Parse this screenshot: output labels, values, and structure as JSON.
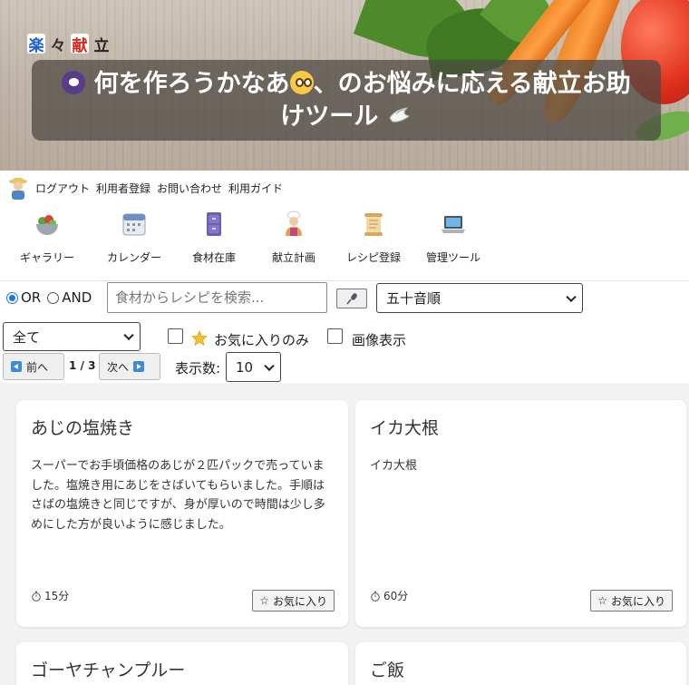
{
  "header": {
    "logo_chars": [
      "楽",
      "々",
      "献",
      "立"
    ],
    "title": "何を作ろうかなあ",
    "title_tail": "、のお悩みに応える献立お助けツール"
  },
  "top_links": [
    "ログアウト",
    "利用者登録",
    "お問い合わせ",
    "利用ガイド"
  ],
  "nav": [
    {
      "label": "ギャラリー",
      "icon": "salad-bowl-icon"
    },
    {
      "label": "カレンダー",
      "icon": "calendar-icon"
    },
    {
      "label": "食材在庫",
      "icon": "file-cabinet-icon"
    },
    {
      "label": "献立計画",
      "icon": "cook-icon"
    },
    {
      "label": "レシピ登録",
      "icon": "scroll-icon"
    },
    {
      "label": "管理ツール",
      "icon": "laptop-icon"
    }
  ],
  "search": {
    "mode_or": "OR",
    "mode_and": "AND",
    "selected_mode": "OR",
    "placeholder": "食材からレシピを検索...",
    "value": "",
    "sort": "五十音順",
    "category": "全て",
    "favorites_only": "お気に入りのみ",
    "show_images": "画像表示"
  },
  "pager": {
    "prev": "前へ",
    "next": "次へ",
    "indicator": "1 / 3",
    "per_page_label": "表示数:",
    "per_page": "10"
  },
  "recipes": [
    {
      "title": "あじの塩焼き",
      "description": "スーパーでお手頃価格のあじが２匹パックで売っていました。塩焼き用にあじをさばいてもらいました。手順はさばの塩焼きと同じですが、身が厚いので時間は少し多めにした方が良いように感じました。",
      "time": "15分",
      "fav_label": "お気に入り"
    },
    {
      "title": "イカ大根",
      "description": "イカ大根",
      "time": "60分",
      "fav_label": "お気に入り"
    },
    {
      "title": "ゴーヤチャンプルー"
    },
    {
      "title": "ご飯"
    }
  ]
}
